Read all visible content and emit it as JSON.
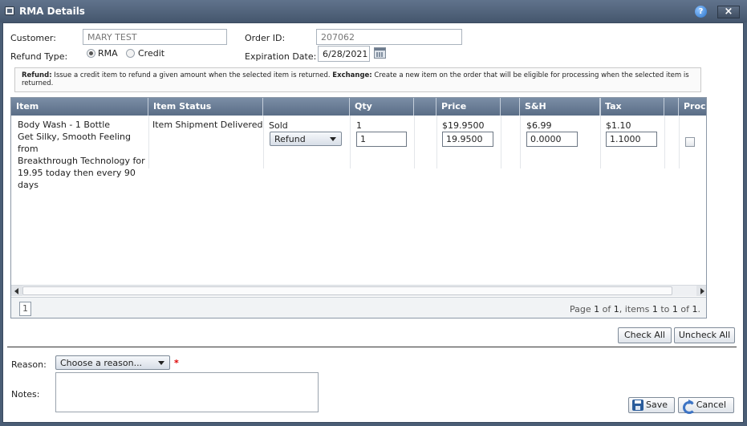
{
  "window": {
    "title": "RMA Details",
    "help_icon": "question-icon",
    "close_icon": "close-icon"
  },
  "form": {
    "customer_label": "Customer:",
    "customer_value": "MARY TEST",
    "order_id_label": "Order ID:",
    "order_id_value": "207062",
    "refund_type_label": "Refund Type:",
    "refund_type_options": [
      "RMA",
      "Credit"
    ],
    "refund_type_selected": "RMA",
    "expiration_label": "Expiration Date:",
    "expiration_value": "6/28/2021"
  },
  "info": {
    "refund_bold": "Refund:",
    "refund_text": " Issue a credit item to refund a given amount when the selected item is returned. ",
    "exchange_bold": "Exchange:",
    "exchange_text": " Create a new item on the order that will be eligible for processing when the selected item is returned."
  },
  "grid": {
    "columns": [
      "Item",
      "Item Status",
      "",
      "Qty",
      "",
      "Price",
      "",
      "S&H",
      "",
      "Tax",
      "",
      "Proce"
    ],
    "rows": [
      {
        "item_lines": [
          "Body Wash - 1 Bottle",
          "Get Silky, Smooth Feeling from",
          "Breakthrough Technology for",
          "19.95 today then every 90 days"
        ],
        "status": "Item Shipment Delivered",
        "type_label": "Sold",
        "type_select": "Refund",
        "qty": "1",
        "qty_input": "1",
        "price": "$19.9500",
        "price_input": "19.9500",
        "sh": "$6.99",
        "sh_input": "0.0000",
        "tax": "$1.10",
        "tax_input": "1.1000",
        "process_checked": false
      }
    ],
    "pager": {
      "page": "1",
      "text_prefix": "Page ",
      "cur": "1",
      "of": " of ",
      "total": "1",
      "items": ", items ",
      "from": "1",
      "to": " to ",
      "to_n": "1",
      "of2": " of ",
      "count": "1",
      "end": "."
    }
  },
  "buttons": {
    "check_all": "Check All",
    "uncheck_all": "Uncheck All",
    "save": "Save",
    "cancel": "Cancel"
  },
  "reason": {
    "label": "Reason:",
    "placeholder": "Choose a reason...",
    "required_mark": "*"
  },
  "notes": {
    "label": "Notes:"
  },
  "colors": {
    "header": "#5a6d86",
    "titlebar": "#45566d",
    "required": "#dd0000"
  }
}
